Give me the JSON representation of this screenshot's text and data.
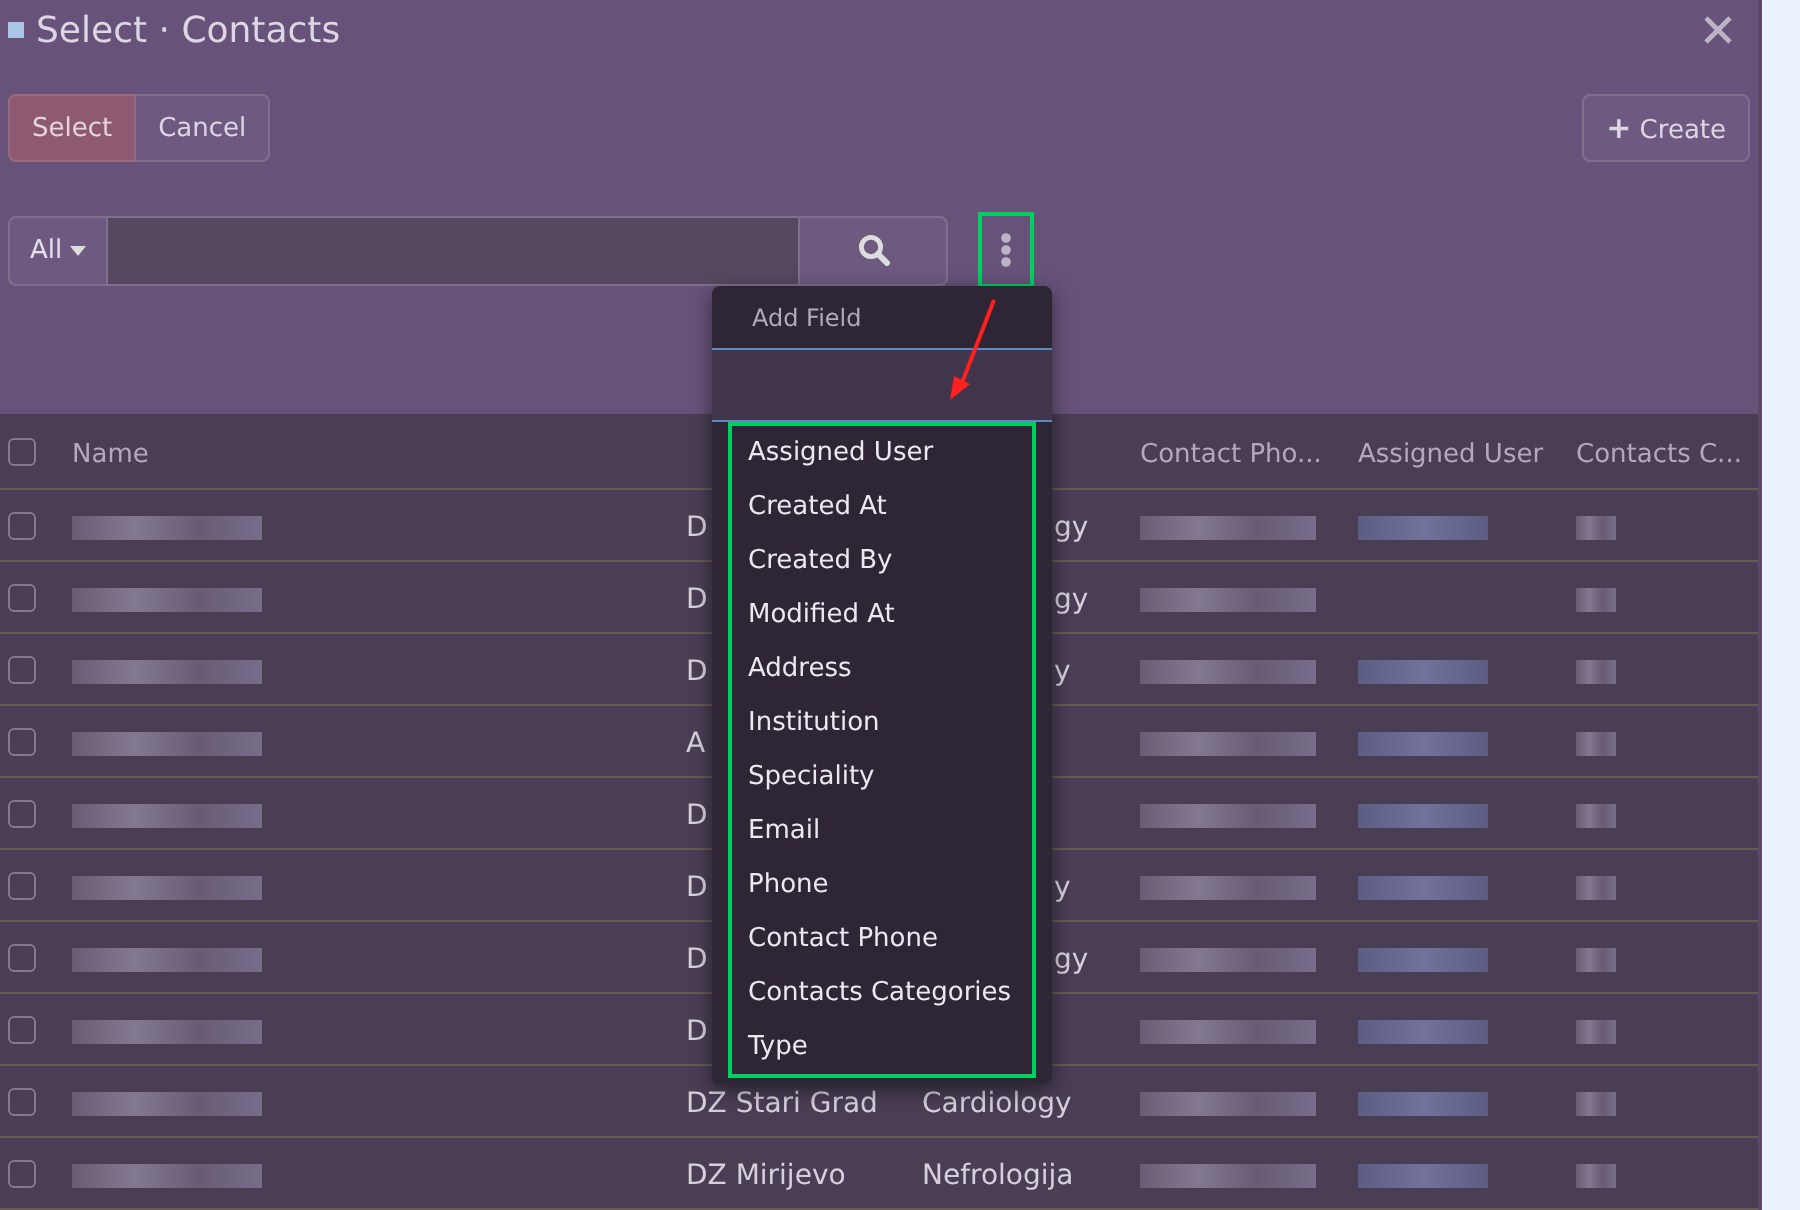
{
  "window": {
    "title": "Select · Contacts"
  },
  "actions": [
    {
      "label": "Select",
      "kind": "primary"
    },
    {
      "label": "Cancel",
      "kind": "default"
    }
  ],
  "create_button": {
    "icon": "+",
    "label": "Create"
  },
  "search": {
    "scope": "All"
  },
  "menu_button": {
    "highlighted": true
  },
  "field_menu": {
    "title": "Add Field",
    "highlighted": true,
    "pointer_arrow": true,
    "items": [
      "Assigned User",
      "Created At",
      "Created By",
      "Modified At",
      "Address",
      "Institution",
      "Speciality",
      "Email",
      "Phone",
      "Contact Phone",
      "Contacts Categories",
      "Type"
    ]
  },
  "table": {
    "all_checked": false,
    "columns": [
      "Name",
      "",
      "",
      "Contact Pho...",
      "Assigned User",
      "Contacts C..."
    ],
    "rows": [
      {
        "checked": false,
        "cells": [
          {
            "kind": "blur"
          },
          {
            "kind": "text",
            "text": "D"
          },
          {
            "kind": "tail",
            "text": "gy"
          },
          {
            "kind": "blur"
          },
          {
            "kind": "blur"
          },
          {
            "kind": "blur"
          }
        ]
      },
      {
        "checked": false,
        "cells": [
          {
            "kind": "blur"
          },
          {
            "kind": "text",
            "text": "D"
          },
          {
            "kind": "tail",
            "text": "gy"
          },
          {
            "kind": "blur"
          },
          {
            "kind": "none"
          },
          {
            "kind": "blur"
          }
        ]
      },
      {
        "checked": false,
        "cells": [
          {
            "kind": "blur"
          },
          {
            "kind": "text",
            "text": "D"
          },
          {
            "kind": "tail",
            "text": "y"
          },
          {
            "kind": "blur"
          },
          {
            "kind": "blur"
          },
          {
            "kind": "blur"
          }
        ]
      },
      {
        "checked": false,
        "cells": [
          {
            "kind": "blur"
          },
          {
            "kind": "text",
            "text": "A"
          },
          {
            "kind": "none"
          },
          {
            "kind": "blur"
          },
          {
            "kind": "blur"
          },
          {
            "kind": "blur"
          }
        ]
      },
      {
        "checked": false,
        "cells": [
          {
            "kind": "blur"
          },
          {
            "kind": "text",
            "text": "D"
          },
          {
            "kind": "none"
          },
          {
            "kind": "blur"
          },
          {
            "kind": "blur"
          },
          {
            "kind": "blur"
          }
        ]
      },
      {
        "checked": false,
        "cells": [
          {
            "kind": "blur"
          },
          {
            "kind": "text",
            "text": "D"
          },
          {
            "kind": "tail",
            "text": "y"
          },
          {
            "kind": "blur"
          },
          {
            "kind": "blur"
          },
          {
            "kind": "blur"
          }
        ]
      },
      {
        "checked": false,
        "cells": [
          {
            "kind": "blur"
          },
          {
            "kind": "text",
            "text": "D"
          },
          {
            "kind": "tail",
            "text": "gy"
          },
          {
            "kind": "blur"
          },
          {
            "kind": "blur"
          },
          {
            "kind": "blur"
          }
        ]
      },
      {
        "checked": false,
        "cells": [
          {
            "kind": "blur"
          },
          {
            "kind": "text",
            "text": "D"
          },
          {
            "kind": "none"
          },
          {
            "kind": "blur"
          },
          {
            "kind": "blur"
          },
          {
            "kind": "blur"
          }
        ]
      },
      {
        "checked": false,
        "cells": [
          {
            "kind": "blur"
          },
          {
            "kind": "text",
            "text": "DZ Stari Grad"
          },
          {
            "kind": "text",
            "text": "Cardiology"
          },
          {
            "kind": "blur"
          },
          {
            "kind": "blur"
          },
          {
            "kind": "blur"
          }
        ]
      },
      {
        "checked": false,
        "cells": [
          {
            "kind": "blur"
          },
          {
            "kind": "text",
            "text": "DZ Mirijevo"
          },
          {
            "kind": "text",
            "text": "Nefrologija"
          },
          {
            "kind": "blur"
          },
          {
            "kind": "blur"
          },
          {
            "kind": "blur"
          }
        ]
      }
    ]
  }
}
